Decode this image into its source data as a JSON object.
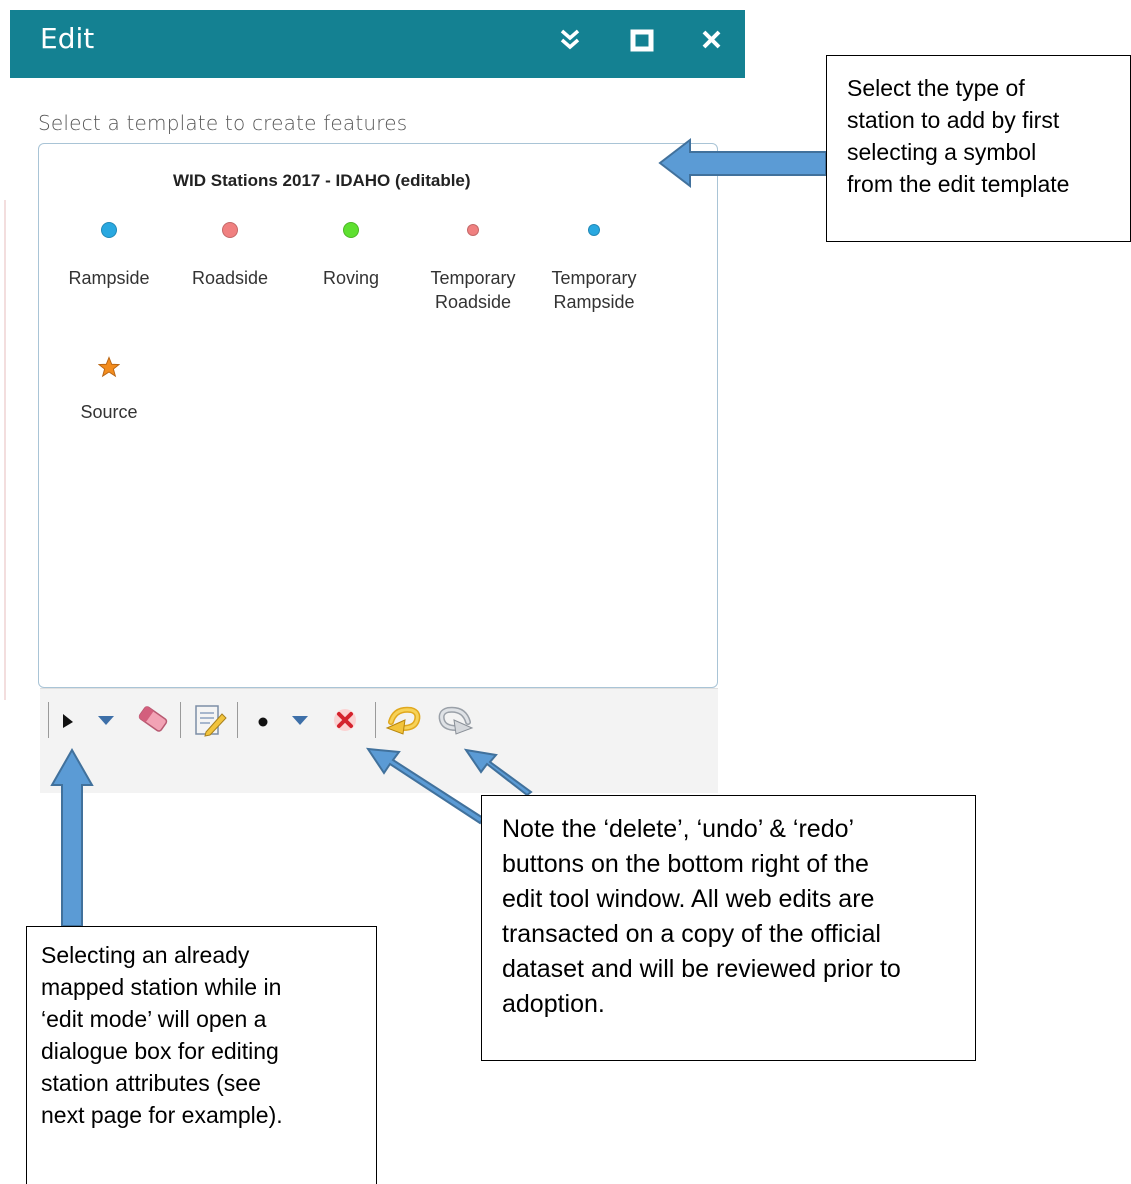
{
  "panel": {
    "title": "Edit",
    "header_color": "#148192",
    "header_icons": [
      "chevron-double-down-icon",
      "maximize-icon",
      "close-icon"
    ]
  },
  "template_picker": {
    "prompt": "Select a template to create features",
    "layer_title": "WID Stations 2017 - IDAHO (editable)",
    "templates": [
      {
        "label_line1": "Rampside",
        "label_line2": "",
        "symbol": "circle",
        "color": "#29a8e0"
      },
      {
        "label_line1": "Roadside",
        "label_line2": "",
        "symbol": "circle",
        "color": "#f08080"
      },
      {
        "label_line1": "Roving",
        "label_line2": "",
        "symbol": "circle",
        "color": "#5ee030"
      },
      {
        "label_line1": "Temporary",
        "label_line2": "Roadside",
        "symbol": "circle-small",
        "color": "#f08080"
      },
      {
        "label_line1": "Temporary",
        "label_line2": "Rampside",
        "symbol": "circle-small",
        "color": "#29a8e0"
      },
      {
        "label_line1": "Source",
        "label_line2": "",
        "symbol": "star",
        "color": "#f28c1e"
      }
    ]
  },
  "toolbar": {
    "tools": [
      "select-arrow-icon",
      "dropdown-icon",
      "eraser-icon",
      "edit-attributes-icon",
      "point-icon",
      "dropdown-icon",
      "delete-icon",
      "undo-icon",
      "redo-icon"
    ]
  },
  "callouts": {
    "template_note": [
      "Select the type of",
      "station to add by first",
      "selecting a symbol",
      "from the edit template"
    ],
    "buttons_note": [
      "Note the ‘delete’, ‘undo’ & ‘redo’",
      "buttons on the bottom right of the",
      "edit tool window.  All web edits are",
      "transacted on a copy of the official",
      "dataset and will be reviewed prior to",
      "adoption."
    ],
    "select_note": [
      "Selecting an already",
      "mapped station while in",
      "‘edit mode’ will open a",
      "dialogue box for editing",
      "station attributes (see",
      "next page for example)."
    ]
  },
  "arrow_color": "#5b9bd5"
}
